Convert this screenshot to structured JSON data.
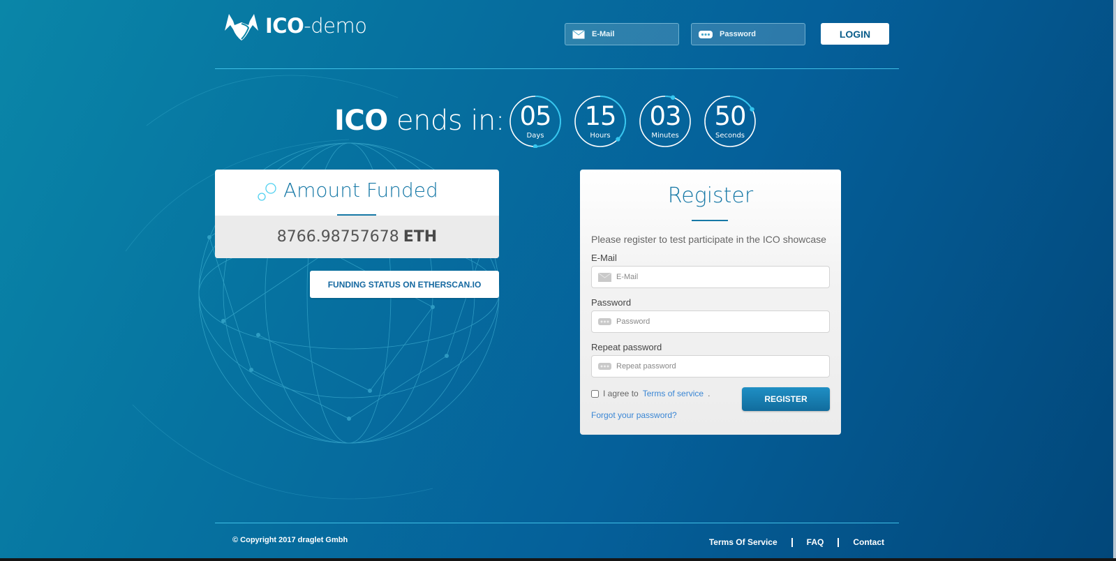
{
  "header": {
    "brand_bold": "ICO",
    "brand_light": "-demo",
    "email_placeholder": "E-Mail",
    "password_placeholder": "Password",
    "login_label": "LOGIN"
  },
  "countdown": {
    "label_bold": "ICO",
    "label_rest": " ends in:",
    "units": [
      {
        "value": "05",
        "label": "Days",
        "fraction": 0.5
      },
      {
        "value": "15",
        "label": "Hours",
        "fraction": 0.375
      },
      {
        "value": "03",
        "label": "Minutes",
        "fraction": 0.05
      },
      {
        "value": "50",
        "label": "Seconds",
        "fraction": 0.17
      }
    ],
    "ring_color": "#ffffff",
    "progress_color": "#35c6ef"
  },
  "amount": {
    "title": "Amount Funded",
    "value": "8766.98757678",
    "currency": "ETH",
    "etherscan_label": "FUNDING STATUS ON ETHERSCAN.IO"
  },
  "register": {
    "title": "Register",
    "intro": "Please register to test participate in the ICO showcase",
    "email_label": "E-Mail",
    "email_placeholder": "E-Mail",
    "password_label": "Password",
    "password_placeholder": "Password",
    "repeat_label": "Repeat password",
    "repeat_placeholder": "Repeat password",
    "agree_text": "I agree to",
    "terms_link": "Terms of service",
    "agree_suffix": ".",
    "button_label": "REGISTER",
    "forgot_link": "Forgot your password?"
  },
  "footer": {
    "copyright": "© Copyright 2017 draglet Gmbh",
    "links": [
      "Terms Of Service",
      "FAQ",
      "Contact"
    ]
  },
  "colors": {
    "accent": "#1678a6",
    "link": "#3a86d4",
    "background_light": "#0a86a8",
    "background_dark": "#02477a"
  }
}
